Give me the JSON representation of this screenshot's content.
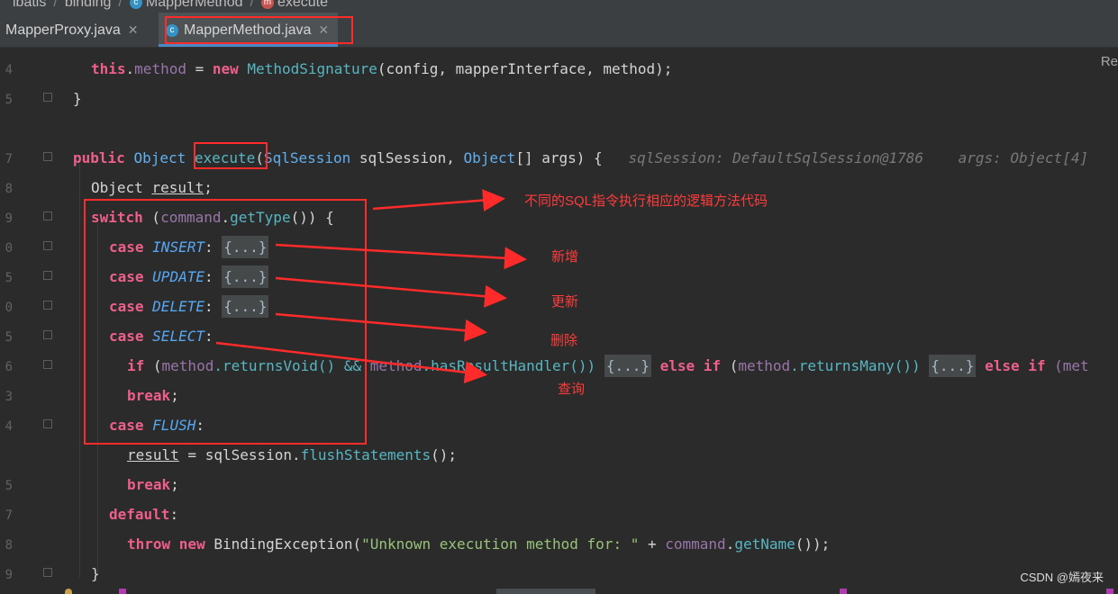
{
  "breadcrumb": [
    "ibatis",
    "binding",
    "MapperMethod",
    "execute"
  ],
  "tabs": [
    {
      "label": "MapperProxy.java",
      "active": false
    },
    {
      "label": "MapperMethod.java",
      "active": true
    }
  ],
  "right_hint": "Re",
  "gutter_numbers": [
    "4",
    "",
    "5",
    "",
    "7",
    "8",
    "9",
    "0",
    "5",
    "0",
    "5",
    "6",
    "3",
    "4",
    "",
    "5",
    "7",
    "8",
    "9"
  ],
  "code": {
    "l1_this": "this",
    "l1_method": "method",
    "l1_new": "new",
    "l1_class": "MethodSignature",
    "l1_args": "(config, mapperInterface, method);",
    "l2": "}",
    "l4_public": "public",
    "l4_object": "Object",
    "l4_execute": "execute",
    "l4_sig_a": "(",
    "l4_sqlsession_type": "SqlSession",
    "l4_sig_b": " sqlSession, ",
    "l4_object2": "Object",
    "l4_sig_c": "[] args) {",
    "l4_hint1": "sqlSession: DefaultSqlSession@1786",
    "l4_hint2": "args: Object[4]",
    "l5_type": "Object",
    "l5_var": "result",
    "l5_end": ";",
    "l6_switch": "switch",
    "l6_a": " (",
    "l6_command": "command",
    "l6_b": ".",
    "l6_gettype": "getType",
    "l6_c": "()) {",
    "case_kw": "case",
    "insert": "INSERT",
    "update": "UPDATE",
    "delete": "DELETE",
    "select": "SELECT",
    "flush": "FLUSH",
    "colon": ":",
    "folded": "{...}",
    "l11_if": "if",
    "l11_a": " (",
    "l11_method": "method",
    "l11_rv": ".returnsVoid() && ",
    "l11_method2": "method",
    "l11_hrh": ".hasResultHandler()) ",
    "l11_else": "else if",
    "l11_b": " (",
    "l11_method3": "method",
    "l11_rm": ".returnsMany()) ",
    "l11_else2": "else if",
    "l11_c": " (met",
    "break_kw": "break",
    "semi": ";",
    "l14_result": "result",
    "l14_mid": " = sqlSession.",
    "l14_fn": "flushStatements",
    "l14_end": "();",
    "default_kw": "default",
    "l17_throw": "throw new",
    "l17_cls": " BindingException(",
    "l17_str": "\"Unknown execution method for: \"",
    "l17_plus": " + ",
    "l17_cmd": "command",
    "l17_dot": ".",
    "l17_getname": "getName",
    "l17_end": "());",
    "l18": "}"
  },
  "annotations": {
    "main": "不同的SQL指令执行相应的逻辑方法代码",
    "insert": "新增",
    "update": "更新",
    "delete": "删除",
    "select": "查询"
  },
  "watermark": "CSDN @嫣夜来",
  "colors": {
    "background": "#2b2b2b",
    "keyword": "#ee5f8a",
    "annotation_red": "#ff2a2a",
    "enum": "#56a8f5",
    "string": "#98c379"
  }
}
